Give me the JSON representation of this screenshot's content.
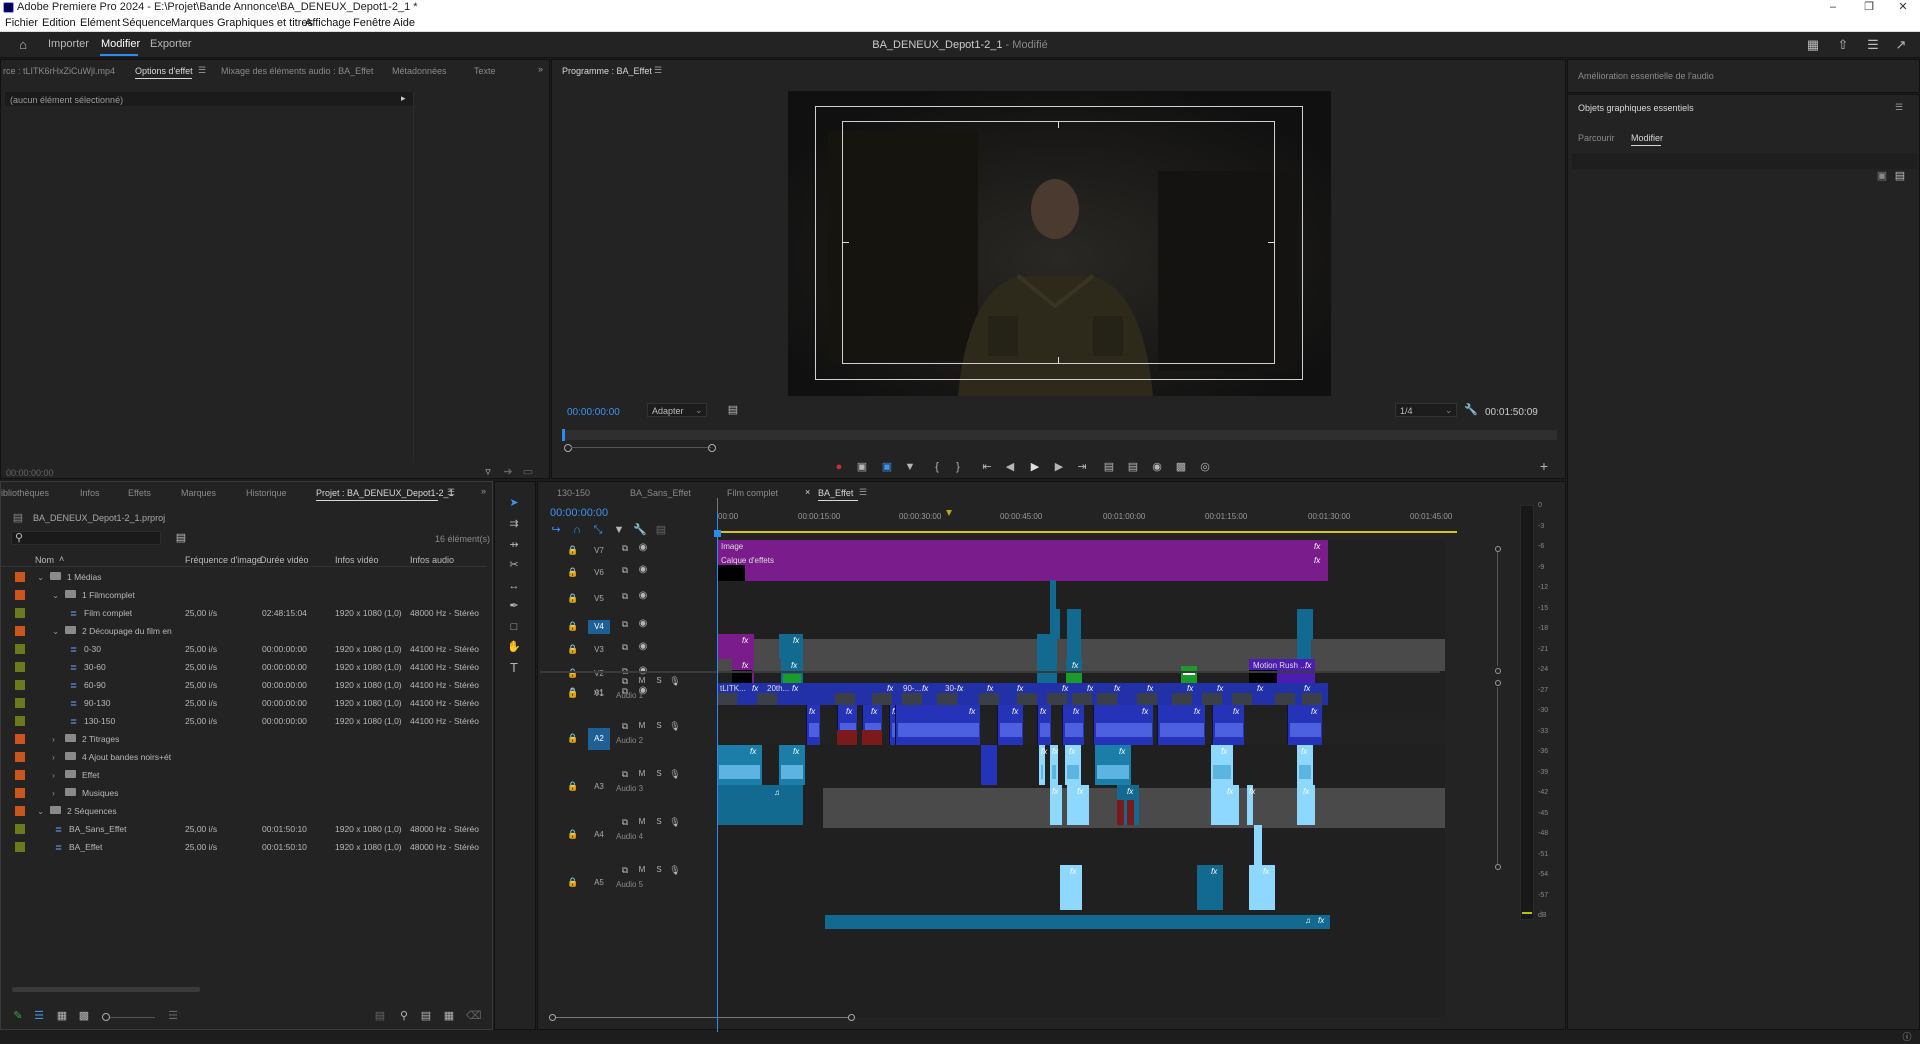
{
  "window": {
    "title": "Adobe Premiere Pro 2024 - E:\\Projet\\Bande Annonce\\BA_DENEUX_Depot1-2_1 *"
  },
  "menu": [
    "Fichier",
    "Edition",
    "Elément",
    "Séquence",
    "Marques",
    "Graphiques et titres",
    "Affichage",
    "Fenêtre",
    "Aide"
  ],
  "header": {
    "import": "Importer",
    "edit": "Modifier",
    "export": "Exporter",
    "project_title": "BA_DENEUX_Depot1-2_1",
    "modified": " - Modifié"
  },
  "source_panel": {
    "tabs": [
      "rce : tLITK6rHxZiCuWjl.mp4",
      "Options d'effet",
      "Mixage des éléments audio : BA_Effet",
      "Métadonnées",
      "Texte"
    ],
    "no_selection": "(aucun élément sélectionné)",
    "timecode": "00:00:00:00"
  },
  "program": {
    "tab": "Programme : BA_Effet",
    "timecode": "00:00:00:00",
    "fit": "Adapter",
    "resolution": "1/4",
    "duration": "00:01:50:09"
  },
  "right_panel": {
    "audio_title": "Amélioration essentielle de l'audio",
    "graphics_title": "Objets graphiques essentiels",
    "tabs": [
      "Parcourir",
      "Modifier"
    ]
  },
  "project_panel": {
    "tabs": [
      "ibliothèques",
      "Infos",
      "Effets",
      "Marques",
      "Historique",
      "Projet : BA_DENEUX_Depot1-2_1"
    ],
    "project_file": "BA_DENEUX_Depot1-2_1.prproj",
    "count": "16 élément(s)",
    "columns": [
      "Nom",
      "Fréquence d'image",
      "Durée vidéo",
      "Infos vidéo",
      "Infos audio"
    ],
    "rows": [
      {
        "name": "1 Médias",
        "fps": "",
        "dur": "",
        "video": "",
        "audio": "",
        "indent": 0,
        "type": "folder",
        "open": true,
        "color": "#c8561d"
      },
      {
        "name": "1 Filmcomplet",
        "fps": "",
        "dur": "",
        "video": "",
        "audio": "",
        "indent": 1,
        "type": "folder",
        "open": true,
        "color": "#c8561d"
      },
      {
        "name": "Film complet",
        "fps": "25,00 i/s",
        "dur": "02:48:15:04",
        "video": "1920 x 1080 (1,0)",
        "audio": "48000 Hz - Stéréo",
        "indent": 2,
        "type": "seq",
        "color": "#6b7a1c"
      },
      {
        "name": "2 Découpage du film en",
        "fps": "",
        "dur": "",
        "video": "",
        "audio": "",
        "indent": 1,
        "type": "folder",
        "open": true,
        "color": "#c8561d"
      },
      {
        "name": "0-30",
        "fps": "25,00 i/s",
        "dur": "00:00:00:00",
        "video": "1920 x 1080 (1,0)",
        "audio": "44100 Hz - Stéréo",
        "indent": 2,
        "type": "seq",
        "color": "#6b7a1c"
      },
      {
        "name": "30-60",
        "fps": "25,00 i/s",
        "dur": "00:00:00:00",
        "video": "1920 x 1080 (1,0)",
        "audio": "44100 Hz - Stéréo",
        "indent": 2,
        "type": "seq",
        "color": "#6b7a1c"
      },
      {
        "name": "60-90",
        "fps": "25,00 i/s",
        "dur": "00:00:00:00",
        "video": "1920 x 1080 (1,0)",
        "audio": "44100 Hz - Stéréo",
        "indent": 2,
        "type": "seq",
        "color": "#6b7a1c"
      },
      {
        "name": "90-130",
        "fps": "25,00 i/s",
        "dur": "00:00:00:00",
        "video": "1920 x 1080 (1,0)",
        "audio": "44100 Hz - Stéréo",
        "indent": 2,
        "type": "seq",
        "color": "#6b7a1c"
      },
      {
        "name": "130-150",
        "fps": "25,00 i/s",
        "dur": "00:00:00:00",
        "video": "1920 x 1080 (1,0)",
        "audio": "44100 Hz - Stéréo",
        "indent": 2,
        "type": "seq",
        "color": "#6b7a1c"
      },
      {
        "name": "2 Titrages",
        "fps": "",
        "dur": "",
        "video": "",
        "audio": "",
        "indent": 1,
        "type": "folder",
        "open": false,
        "color": "#c8561d"
      },
      {
        "name": "4 Ajout bandes noirs+ét",
        "fps": "",
        "dur": "",
        "video": "",
        "audio": "",
        "indent": 1,
        "type": "folder",
        "open": false,
        "color": "#c8561d"
      },
      {
        "name": "Effet",
        "fps": "",
        "dur": "",
        "video": "",
        "audio": "",
        "indent": 1,
        "type": "folder",
        "open": false,
        "color": "#c8561d"
      },
      {
        "name": "Musiques",
        "fps": "",
        "dur": "",
        "video": "",
        "audio": "",
        "indent": 1,
        "type": "folder",
        "open": false,
        "color": "#c8561d"
      },
      {
        "name": "2 Séquences",
        "fps": "",
        "dur": "",
        "video": "",
        "audio": "",
        "indent": 0,
        "type": "folder",
        "open": true,
        "color": "#c8561d"
      },
      {
        "name": "BA_Sans_Effet",
        "fps": "25,00 i/s",
        "dur": "00:01:50:10",
        "video": "1920 x 1080 (1,0)",
        "audio": "48000 Hz - Stéréo",
        "indent": 1,
        "type": "seq",
        "color": "#6b7a1c"
      },
      {
        "name": "BA_Effet",
        "fps": "25,00 i/s",
        "dur": "00:01:50:10",
        "video": "1920 x 1080 (1,0)",
        "audio": "48000 Hz - Stéréo",
        "indent": 1,
        "type": "seq",
        "color": "#6b7a1c"
      }
    ]
  },
  "timeline": {
    "tabs": [
      "130-150",
      "BA_Sans_Effet",
      "Film complet",
      "BA_Effet"
    ],
    "timecode": "00:00:00:00",
    "ruler": [
      "00:00",
      "00:00:15:00",
      "00:00:30:00",
      "00:00:45:00",
      "00:01:00:00",
      "00:01:15:00",
      "00:01:30:00",
      "00:01:45:00"
    ],
    "video_tracks": [
      "V7",
      "V6",
      "V5",
      "V4",
      "V3",
      "V2",
      "V1"
    ],
    "audio_tracks": [
      {
        "id": "A1",
        "name": "Audio 1"
      },
      {
        "id": "A2",
        "name": "Audio 2"
      },
      {
        "id": "A3",
        "name": "Audio 3"
      },
      {
        "id": "A4",
        "name": "Audio 4"
      },
      {
        "id": "A5",
        "name": "Audio 5"
      }
    ],
    "clip_labels": {
      "image": "Image",
      "calque": "Calque d'effets",
      "motion": "Motion Rush ...",
      "v1a": "tLITK...",
      "v1b": "20th...",
      "v1c": "90-...",
      "v1d": "30-..."
    },
    "meter_scale": [
      "0",
      "-3",
      "-6",
      "-9",
      "-12",
      "-15",
      "-18",
      "-21",
      "-24",
      "-27",
      "-30",
      "-33",
      "-36",
      "-39",
      "-42",
      "-45",
      "-48",
      "-51",
      "-54",
      "-57",
      "dB"
    ]
  }
}
